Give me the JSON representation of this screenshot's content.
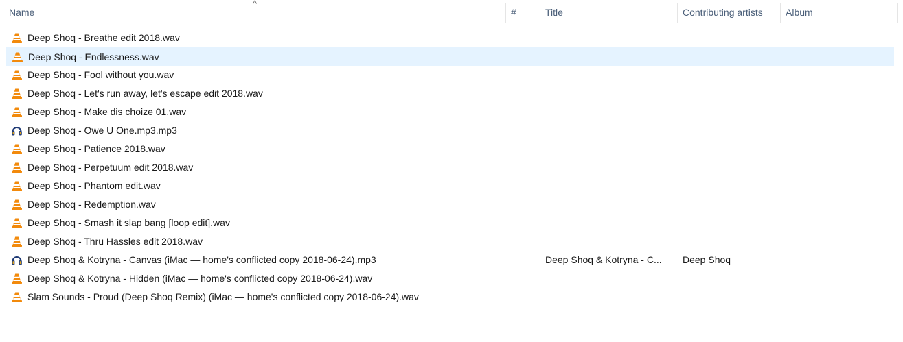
{
  "sort_indicator": "^",
  "columns": [
    {
      "id": "name",
      "label": "Name"
    },
    {
      "id": "number",
      "label": "#"
    },
    {
      "id": "title",
      "label": "Title"
    },
    {
      "id": "artists",
      "label": "Contributing artists"
    },
    {
      "id": "album",
      "label": "Album"
    }
  ],
  "files": [
    {
      "name": "Deep Shoq - Breathe edit 2018.wav",
      "icon": "vlc-cone-icon",
      "title": "",
      "artists": "",
      "selected": false
    },
    {
      "name": "Deep Shoq - Endlessness.wav",
      "icon": "vlc-cone-icon",
      "title": "",
      "artists": "",
      "selected": true
    },
    {
      "name": "Deep Shoq - Fool without you.wav",
      "icon": "vlc-cone-icon",
      "title": "",
      "artists": "",
      "selected": false
    },
    {
      "name": "Deep Shoq - Let's run away, let's escape edit 2018.wav",
      "icon": "vlc-cone-icon",
      "title": "",
      "artists": "",
      "selected": false
    },
    {
      "name": "Deep Shoq - Make dis choize 01.wav",
      "icon": "vlc-cone-icon",
      "title": "",
      "artists": "",
      "selected": false
    },
    {
      "name": "Deep Shoq - Owe U One.mp3.mp3",
      "icon": "headphones-icon",
      "title": "",
      "artists": "",
      "selected": false
    },
    {
      "name": "Deep Shoq - Patience 2018.wav",
      "icon": "vlc-cone-icon",
      "title": "",
      "artists": "",
      "selected": false
    },
    {
      "name": "Deep Shoq - Perpetuum edit 2018.wav",
      "icon": "vlc-cone-icon",
      "title": "",
      "artists": "",
      "selected": false
    },
    {
      "name": "Deep Shoq - Phantom edit.wav",
      "icon": "vlc-cone-icon",
      "title": "",
      "artists": "",
      "selected": false
    },
    {
      "name": "Deep Shoq - Redemption.wav",
      "icon": "vlc-cone-icon",
      "title": "",
      "artists": "",
      "selected": false
    },
    {
      "name": "Deep Shoq - Smash it slap bang [loop edit].wav",
      "icon": "vlc-cone-icon",
      "title": "",
      "artists": "",
      "selected": false
    },
    {
      "name": "Deep Shoq - Thru Hassles edit 2018.wav",
      "icon": "vlc-cone-icon",
      "title": "",
      "artists": "",
      "selected": false
    },
    {
      "name": "Deep Shoq & Kotryna - Canvas (iMac — home's conflicted copy 2018-06-24).mp3",
      "icon": "headphones-icon",
      "title": "Deep Shoq & Kotryna - C...",
      "artists": "Deep Shoq",
      "selected": false
    },
    {
      "name": "Deep Shoq & Kotryna - Hidden (iMac — home's conflicted copy 2018-06-24).wav",
      "icon": "vlc-cone-icon",
      "title": "",
      "artists": "",
      "selected": false
    },
    {
      "name": "Slam Sounds - Proud (Deep Shoq Remix) (iMac — home's conflicted copy 2018-06-24).wav",
      "icon": "vlc-cone-icon",
      "title": "",
      "artists": "",
      "selected": false
    }
  ],
  "colors": {
    "header_text": "#4c607a",
    "selection": "#e5f3ff",
    "vlc_orange": "#f28a0c",
    "headphones": "#1f3a75"
  }
}
